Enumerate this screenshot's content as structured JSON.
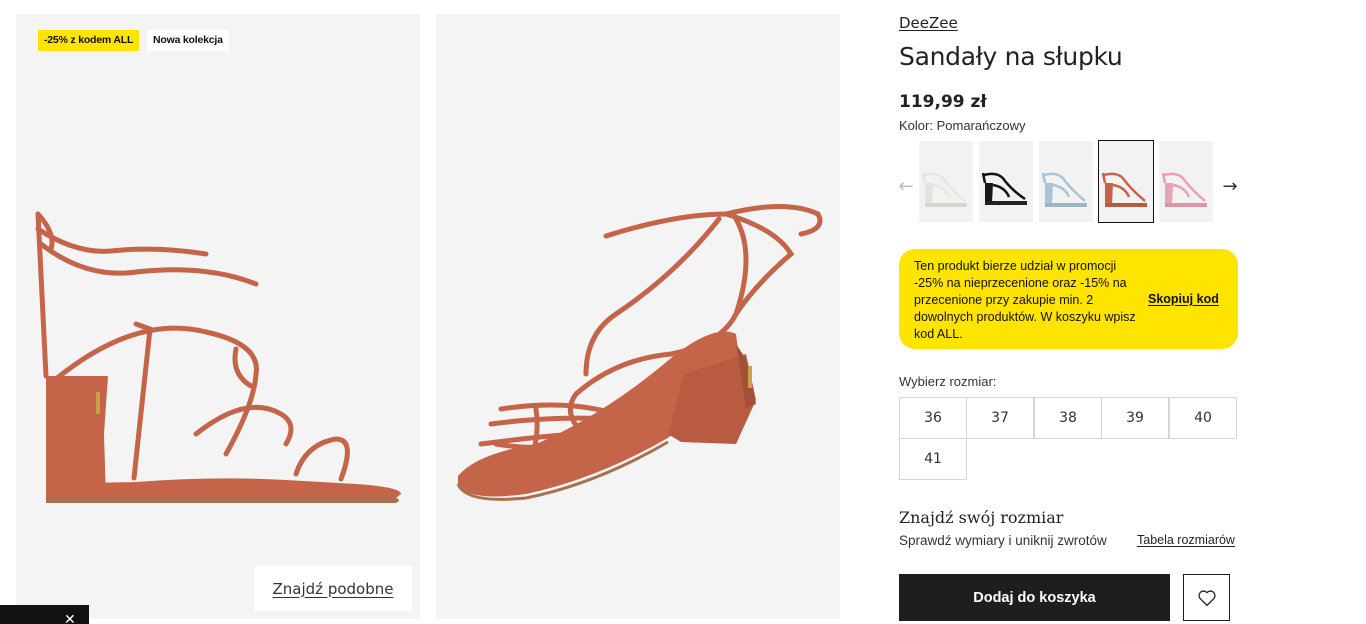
{
  "gallery": {
    "badge_promo": "-25% z kodem ALL",
    "badge_new": "Nowa kolekcja",
    "find_similar": "Znajdź podobne"
  },
  "product": {
    "brand": "DeeZee",
    "title": "Sandały na słupku",
    "price": "119,99 zł",
    "color_label": "Kolor:",
    "color_value": "Pomarańczowy",
    "color_variants": [
      "white",
      "black",
      "light-blue",
      "orange",
      "pink"
    ],
    "selected_variant": "orange"
  },
  "promo": {
    "text": "Ten produkt bierze udział w promocji -25% na nieprzecenione oraz -15% na przecenione przy zakupie min. 2 dowolnych produktów. W koszyku wpisz kod ALL.",
    "copy_code": "Skopiuj kod"
  },
  "sizes": {
    "label": "Wybierz rozmiar:",
    "options": [
      "36",
      "37",
      "38",
      "39",
      "40",
      "41"
    ]
  },
  "fit": {
    "title": "Znajdź swój rozmiar",
    "description": "Sprawdź wymiary i uniknij zwrotów",
    "size_table": "Tabela rozmiarów"
  },
  "actions": {
    "add_to_cart": "Dodaj do koszyka"
  },
  "toast": {
    "close": "✕"
  },
  "colors": {
    "accent_yellow": "#ffe400",
    "button_dark": "#1e1e1e",
    "shoe_orange": "#c8684a"
  }
}
